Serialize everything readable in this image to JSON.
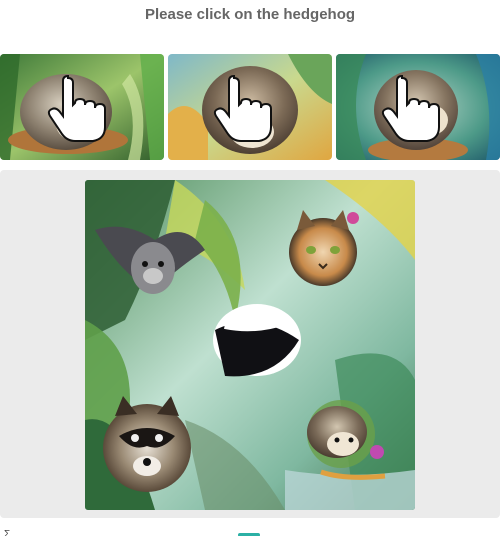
{
  "prompt": {
    "text": "Please click on the hedgehog"
  },
  "examples": {
    "items": [
      {
        "subject": "hedgehog",
        "icon": "hand-pointer-icon"
      },
      {
        "subject": "hedgehog",
        "icon": "hand-pointer-icon"
      },
      {
        "subject": "hedgehog",
        "icon": "hand-pointer-icon"
      }
    ]
  },
  "puzzle": {
    "animals": [
      "bat",
      "cat",
      "skunk",
      "raccoon",
      "hedgehog"
    ]
  },
  "footer": {
    "text": "Σ"
  },
  "colors": {
    "prompt_text": "#666666",
    "frame_bg": "#ebebeb",
    "accent": "#2bb0a5"
  }
}
